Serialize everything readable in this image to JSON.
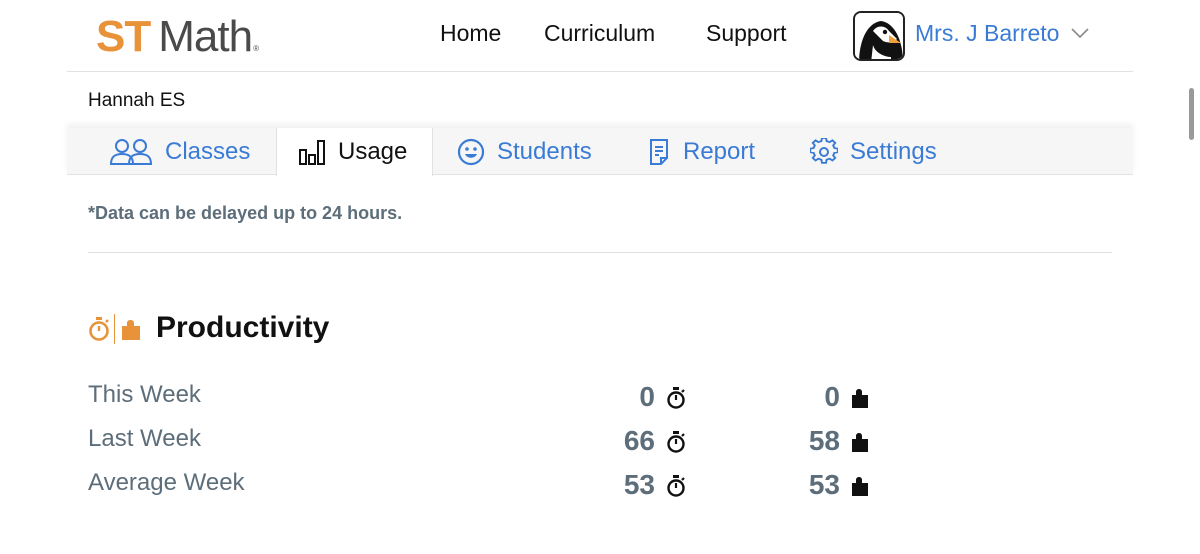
{
  "header": {
    "logo_st": "ST",
    "logo_math": "Math",
    "logo_reg": "®",
    "nav": [
      "Home",
      "Curriculum",
      "Support"
    ],
    "user_name": "Mrs. J Barreto",
    "avatar_icon": "penguin-avatar",
    "user_menu_icon": "chevron-down-icon"
  },
  "school_name": "Hannah ES",
  "tabs": [
    {
      "label": "Classes",
      "icon": "people-icon",
      "active": false
    },
    {
      "label": "Usage",
      "icon": "bar-chart-icon",
      "active": true
    },
    {
      "label": "Students",
      "icon": "smiley-icon",
      "active": false
    },
    {
      "label": "Report",
      "icon": "report-icon",
      "active": false
    },
    {
      "label": "Settings",
      "icon": "gear-icon",
      "active": false
    }
  ],
  "note": "*Data can be delayed up to 24 hours.",
  "productivity": {
    "title": "Productivity",
    "rows": [
      {
        "label": "This Week",
        "minutes": "0",
        "puzzles": "0"
      },
      {
        "label": "Last Week",
        "minutes": "66",
        "puzzles": "58"
      },
      {
        "label": "Average Week",
        "minutes": "53",
        "puzzles": "53"
      }
    ]
  },
  "colors": {
    "brand_orange": "#e8923a",
    "link_blue": "#3a7bd5",
    "muted_text": "#5d6e7a"
  }
}
